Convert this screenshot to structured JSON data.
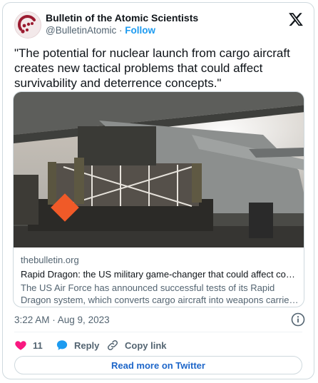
{
  "author": {
    "name": "Bulletin of the Atomic Scientists",
    "handle": "@BulletinAtomic",
    "separator": "·",
    "follow_label": "Follow"
  },
  "tweet": {
    "text": "\"The potential for nuclear launch from cargo aircraft creates new tactical problems that could affect survivability and deterrence concepts.\""
  },
  "link_card": {
    "domain": "thebulletin.org",
    "title": "Rapid Dragon: the US military game-changer that could affect conventional deterrence",
    "description": "The US Air Force has announced successful tests of its Rapid Dragon system, which converts cargo aircraft into weapons carriers that can launch cruise missiles from standoff ranges."
  },
  "timestamp": "3:22 AM · Aug 9, 2023",
  "actions": {
    "like_count": "11",
    "reply_label": "Reply",
    "copy_link_label": "Copy link"
  },
  "read_more_label": "Read more on Twitter",
  "colors": {
    "accent": "#1d9bf0",
    "like": "#f91880",
    "read_more": "#1d66c9",
    "brand_logo": "#9b1b30"
  },
  "icons": [
    "bulletin-logo-icon",
    "x-logo-icon",
    "info-icon",
    "heart-icon",
    "reply-icon",
    "link-icon"
  ]
}
